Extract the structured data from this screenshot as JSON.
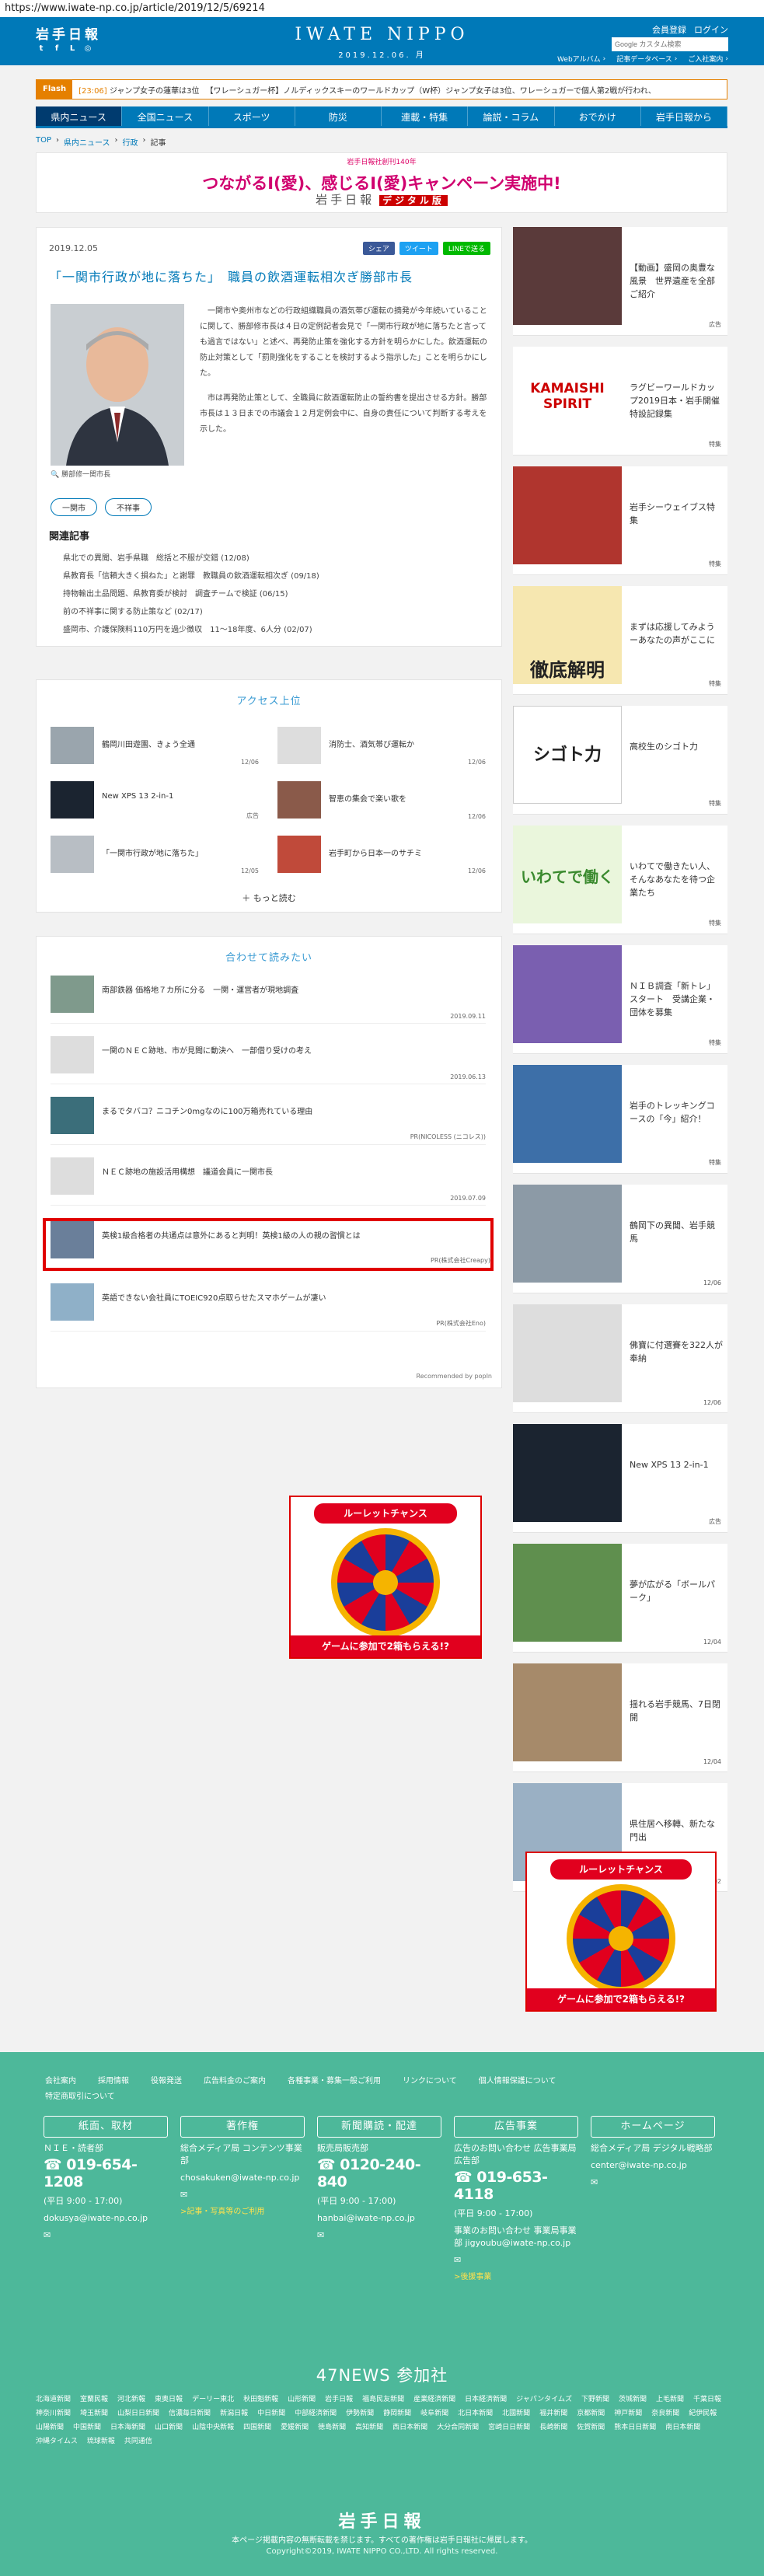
{
  "url": "https://www.iwate-np.co.jp/article/2019/12/5/69214",
  "header": {
    "logo": "岩手日報",
    "site_name": "IWATE NIPPO",
    "date": "2019.12.06. 月",
    "member": "会員登録",
    "login": "ログイン",
    "search_placeholder": "Google カスタム検索",
    "nav": [
      "Webアルバム",
      "記事データベース",
      "ご入社案内"
    ]
  },
  "ticker": {
    "label": "Flash",
    "items": [
      {
        "time": "[23:06]",
        "text": "ジャンプ女子の蓮華は3位"
      },
      {
        "time": "",
        "text": "【ワレーシュガー杯】ノルディックスキーのワールドカップ（W杯）ジャンプ女子は3位、ワレーシュガーで個人第2戦が行われ、"
      }
    ]
  },
  "gnav": [
    "県内ニュース",
    "全国ニュース",
    "スポーツ",
    "防災",
    "連載・特集",
    "論説・コラム",
    "おでかけ",
    "岩手日報から"
  ],
  "breadcrumb": [
    "TOP",
    "県内ニュース",
    "行政",
    "記事"
  ],
  "banner": {
    "small": "岩手日報社創刊140年",
    "title": "つながるI(愛)、感じるI(愛)キャンペーン実施中!",
    "sub": "岩手日報",
    "sub_tag": "デジタル版"
  },
  "article": {
    "date": "2019.12.05",
    "share": [
      "シェア",
      "ツイート",
      "LINEで送る"
    ],
    "title": "「一関市行政が地に落ちた」　職員の飲酒運転相次ぎ勝部市長",
    "caption": "勝部修一関市長",
    "body": [
      "一関市や奥州市などの行政組織職員の酒気帯び運転の摘発が今年続いていることに関して、勝部修市長は４日の定例記者会見で「一関市行政が地に落ちたと言っても過言ではない」と述べ、再発防止策を強化する方針を明らかにした。飲酒運転の防止対策として「罰則強化をすることを検討するよう指示した」ことを明らかにした。",
      "市は再発防止策として、全職員に飲酒運転防止の誓約書を提出させる方針。勝部市長は１３日までの市議会１２月定例会中に、自身の責任について判断する考えを示した。"
    ],
    "tags": [
      "一関市",
      "不祥事"
    ]
  },
  "related": {
    "heading": "関連記事",
    "items": [
      "県北での異聞、岩手県職　総括と不服が交錯 (12/08)",
      "県教育長「信頼大きく損ねた」と謝罪　教職員の飲酒運転相次ぎ (09/18)",
      "持物輸出土品問題、県教育委が検討　調査チームで検証 (06/15)",
      "前の不祥事に関する防止策など (02/17)",
      "盛岡市、介護保険料110万円を過少徴収　11～18年度、6人分 (02/07)"
    ]
  },
  "access": {
    "heading": "アクセス上位",
    "items": [
      {
        "title": "鶴岡川田遊園、きょう全通",
        "date": "12/06"
      },
      {
        "title": "消防士、酒気帯び運転か",
        "date": "12/06"
      },
      {
        "title": "New XPS 13 2-in-1",
        "date": "広告"
      },
      {
        "title": "智恵の集会で楽い歌を",
        "date": "12/06"
      },
      {
        "title": "「一関市行政が地に落ちた」",
        "date": "12/05"
      },
      {
        "title": "岩手町から日本一のサチミ",
        "date": "12/06"
      }
    ],
    "more": "もっと読む"
  },
  "recommend": {
    "heading": "合わせて読みたい",
    "items": [
      {
        "title": "南部鉄器 価格地７カ所に分る　一関・運営者が現地調査",
        "date": "2019.09.11"
      },
      {
        "title": "一関のＮＥＣ跡地、市が見聞に動決へ　一部借り受けの考え",
        "date": "2019.06.13"
      },
      {
        "title": "まるでタバコ？ニコチン0mgなのに100万箱売れている理由",
        "date": "PR(NICOLESS (ニコレス))"
      },
      {
        "title": "ＮＥＣ跡地の施設活用構想　議道会員に一関市長",
        "date": "2019.07.09"
      },
      {
        "title": "英検1級合格者の共通点は意外にあると判明！英検1級の人の親の習慣とは",
        "date": "PR(株式会社Creapy)"
      },
      {
        "title": "英語できない会社員にTOEIC920点取らせたスマホゲームが凄い",
        "date": "PR(株式会社Eno)"
      }
    ],
    "powered": "Recommended by popIn"
  },
  "roulette": {
    "title": "ルーレットチャンス",
    "button": "ゲームに参加で2箱もらえる!?"
  },
  "sidebar": [
    {
      "text": "【動画】盛岡の奥豊な風景　世界遺産を全部ご紹介",
      "date": "広告"
    },
    {
      "text": "ラグビーワールドカップ2019日本・岩手開催特設記録集",
      "date": "特集",
      "thumb": "KAMAISHI SPIRIT"
    },
    {
      "text": "岩手シーウェイブス特集",
      "date": "特集"
    },
    {
      "text": "まずは応援してみようーあなたの声がここに",
      "date": "特集",
      "thumb": "徹底解明"
    },
    {
      "text": "高校生のシゴト力",
      "date": "特集",
      "thumb": "シゴト力"
    },
    {
      "text": "いわてで働きたい人、そんなあなたを待つ企業たち",
      "date": "特集",
      "thumb": "いわてで働く"
    },
    {
      "text": "ＮＩＢ調査「新トレ」スタート　受講企業・団体を募集",
      "date": "特集"
    },
    {
      "text": "岩手のトレッキングコースの「今」紹介！",
      "date": "特集"
    },
    {
      "text": "鶴岡下の異聞、岩手競馬",
      "date": "12/06"
    },
    {
      "text": "佛寶に付選賽を322人が奉納",
      "date": "12/06"
    },
    {
      "text": "New XPS 13 2-in-1",
      "date": "広告"
    },
    {
      "text": "夢が広がる「ボールパーク」",
      "date": "12/04"
    },
    {
      "text": "揺れる岩手競馬、7日閉開",
      "date": "12/04"
    },
    {
      "text": "県住居へ移轉、新たな門出",
      "date": "12/02"
    }
  ],
  "footer": {
    "links": [
      "会社案内",
      "採用情報",
      "役報発送",
      "広告料金のご案内",
      "各種事業・募集一般ご利用",
      "リンクについて",
      "個人情報保護について",
      "特定商取引について"
    ],
    "cols": [
      {
        "btn": "紙面、取材",
        "s1": "ＮＩＥ・読者部",
        "phone": "019-654-1208",
        "hours": "(平日 9:00 - 17:00)",
        "mail": "dokusya@iwate-np.co.jp"
      },
      {
        "btn": "著作権",
        "s1": "総合メディア局 コンテンツ事業部",
        "phone": "",
        "hours": "",
        "mail": "chosakuken@iwate-np.co.jp",
        "note": ">記事・写真等のご利用"
      },
      {
        "btn": "新聞購読・配達",
        "s1": "販売局販売部",
        "phone": "0120-240-840",
        "hours": "(平日 9:00 - 17:00)",
        "mail": "hanbai@iwate-np.co.jp"
      },
      {
        "btn": "広告事業",
        "s1": "広告のお問い合わせ 広告事業局広告部",
        "phone": "019-653-4118",
        "hours": "(平日 9:00 - 17:00)",
        "mail": "",
        "note": "事業のお問い合わせ 事業局事業部 jigyoubu@iwate-np.co.jp",
        "note2": ">後援事業"
      },
      {
        "btn": "ホームページ",
        "s1": "総合メディア局 デジタル戦略部",
        "phone": "",
        "hours": "",
        "mail": "center@iwate-np.co.jp"
      }
    ],
    "news47": "47NEWS 参加社",
    "members": [
      "北海道新聞",
      "室蘭民報",
      "河北新報",
      "東奥日報",
      "デーリー東北",
      "秋田魁新報",
      "山形新聞",
      "岩手日報",
      "福島民友新聞",
      "産業経済新聞",
      "日本経済新聞",
      "ジャパンタイムズ",
      "下野新聞",
      "茨城新聞",
      "上毛新聞",
      "千葉日報",
      "神奈川新聞",
      "埼玉新聞",
      "山梨日日新聞",
      "信濃毎日新聞",
      "新潟日報",
      "中日新聞",
      "中部経済新聞",
      "伊勢新聞",
      "静岡新聞",
      "岐阜新聞",
      "北日本新聞",
      "北國新聞",
      "福井新聞",
      "京都新聞",
      "神戸新聞",
      "奈良新聞",
      "紀伊民報",
      "山陽新聞",
      "中国新聞",
      "日本海新聞",
      "山口新聞",
      "山陰中央新報",
      "四国新聞",
      "愛媛新聞",
      "徳島新聞",
      "高知新聞",
      "西日本新聞",
      "大分合同新聞",
      "宮崎日日新聞",
      "長崎新聞",
      "佐賀新聞",
      "熊本日日新聞",
      "南日本新聞",
      "沖縄タイムス",
      "琉球新報",
      "共同通信"
    ],
    "logo": "岩手日報",
    "notice": "本ページ掲載内容の無断転載を禁じます。すべての著作権は岩手日報社に帰属します。",
    "copyright": "Copyright©2019, IWATE NIPPO CO.,LTD. All rights reserved."
  }
}
